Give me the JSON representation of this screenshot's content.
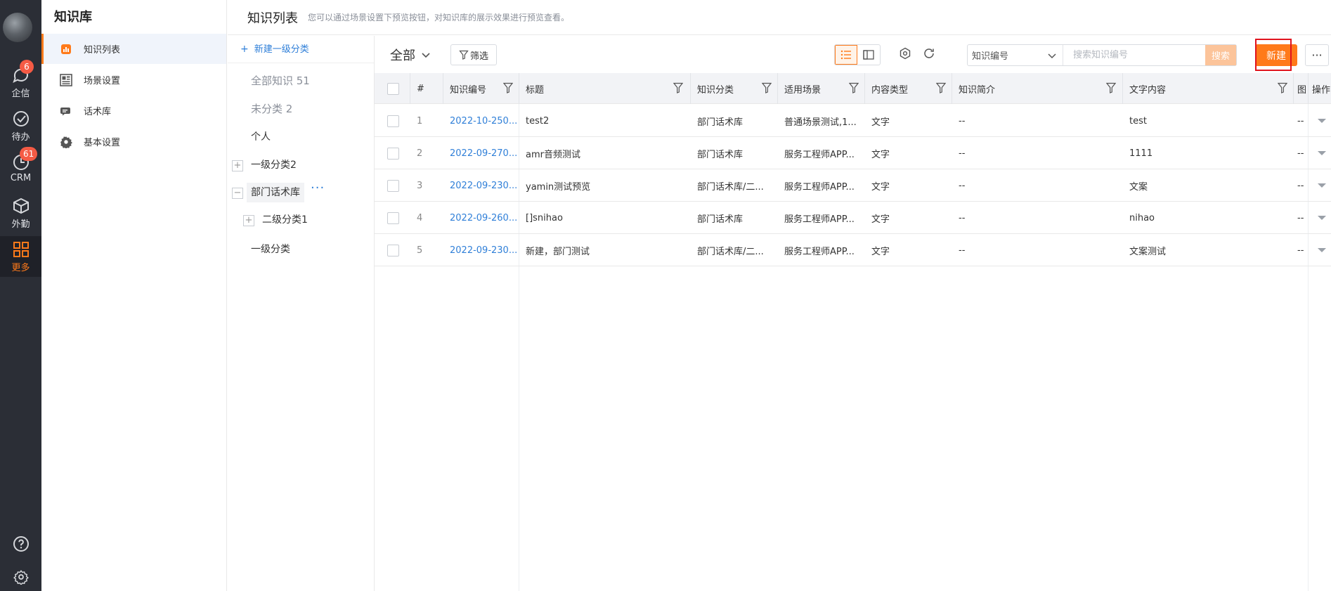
{
  "rail": {
    "items": [
      {
        "label": "企信",
        "badge": "6",
        "icon": "chat-bubble-icon"
      },
      {
        "label": "待办",
        "badge": "",
        "icon": "check-circle-icon"
      },
      {
        "label": "CRM",
        "badge": "61",
        "icon": "clock-icon"
      },
      {
        "label": "外勤",
        "badge": "",
        "icon": "cube-icon"
      },
      {
        "label": "更多",
        "badge": "",
        "icon": "grid-icon"
      }
    ],
    "accent": "#ff7a1a"
  },
  "module": {
    "title": "知识库",
    "items": [
      {
        "label": "知识列表",
        "icon": "bar-chart-icon"
      },
      {
        "label": "场景设置",
        "icon": "layout-icon"
      },
      {
        "label": "话术库",
        "icon": "message-icon"
      },
      {
        "label": "基本设置",
        "icon": "gear-icon"
      }
    ]
  },
  "header": {
    "title": "知识列表",
    "description": "您可以通过场景设置下预览按钮，对知识库的展示效果进行预览查看。"
  },
  "tree": {
    "new_label": "新建一级分类",
    "all_label": "全部知识 51",
    "uncategorized_label": "未分类 2",
    "personal_label": "个人",
    "cat1_label": "一级分类2",
    "dept_label": "部门话术库",
    "dots": "···",
    "sub_label": "二级分类1",
    "cat2_label": "一级分类"
  },
  "toolbar": {
    "view_label": "全部",
    "filter_label": "筛选",
    "search_field": "知识编号",
    "search_placeholder": "搜索知识编号",
    "search_button": "搜索",
    "new_button": "新建",
    "more_button": "···"
  },
  "table": {
    "columns": [
      "#",
      "知识编号",
      "标题",
      "知识分类",
      "适用场景",
      "内容类型",
      "知识简介",
      "文字内容",
      "图",
      "操作"
    ],
    "rows": [
      {
        "n": "1",
        "id": "2022-10-250...",
        "title": "test2",
        "category": "部门话术库",
        "scene": "普通场景测试,1...",
        "type": "文字",
        "intro": "--",
        "text": "test",
        "img": "--"
      },
      {
        "n": "2",
        "id": "2022-09-270...",
        "title": "amr音频测试",
        "category": "部门话术库",
        "scene": "服务工程师APP...",
        "type": "文字",
        "intro": "--",
        "text": "1111",
        "img": "--"
      },
      {
        "n": "3",
        "id": "2022-09-230...",
        "title": "yamin测试预览",
        "category": "部门话术库/二...",
        "scene": "服务工程师APP...",
        "type": "文字",
        "intro": "--",
        "text": "文案",
        "img": "--"
      },
      {
        "n": "4",
        "id": "2022-09-260...",
        "title": "[]snihao",
        "category": "部门话术库",
        "scene": "服务工程师APP...",
        "type": "文字",
        "intro": "--",
        "text": "nihao",
        "img": "--"
      },
      {
        "n": "5",
        "id": "2022-09-230...",
        "title": "新建，部门测试",
        "category": "部门话术库/二...",
        "scene": "服务工程师APP...",
        "type": "文字",
        "intro": "--",
        "text": "文案测试",
        "img": "--"
      }
    ]
  }
}
